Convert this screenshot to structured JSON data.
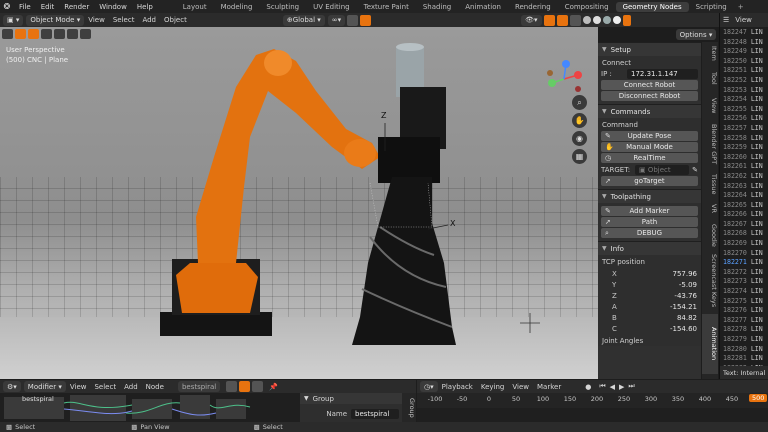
{
  "topbar": {
    "menus": [
      "File",
      "Edit",
      "Render",
      "Window",
      "Help"
    ],
    "workspaces": [
      "Layout",
      "Modeling",
      "Sculpting",
      "UV Editing",
      "Texture Paint",
      "Shading",
      "Animation",
      "Rendering",
      "Compositing",
      "Geometry Nodes",
      "Scripting"
    ],
    "active_workspace": "Geometry Nodes"
  },
  "viewport_header": {
    "mode": "Object Mode",
    "menus": [
      "View",
      "Select",
      "Add",
      "Object"
    ],
    "transform": "Global",
    "options": "Options"
  },
  "viewport": {
    "perspective": "User Perspective",
    "collection": "(500) CNC | Plane",
    "axis_z": "Z",
    "axis_x": "X"
  },
  "npanel": {
    "setup": {
      "title": "Setup",
      "connect_label": "Connect",
      "ip_label": "IP :",
      "ip_value": "172.31.1.147",
      "connect_button": "Connect Robot",
      "disconnect_button": "Disconnect Robot"
    },
    "commands": {
      "title": "Commands",
      "command_label": "Command",
      "update_pose": "Update Pose",
      "manual_mode": "Manual Mode",
      "realtime": "RealTime",
      "target_label": "TARGET:",
      "target_placeholder": "Object",
      "go_target": "goTarget"
    },
    "toolpathing": {
      "title": "Toolpathing",
      "add_marker": "Add Marker",
      "path": "Path",
      "debug": "DEBUG"
    },
    "info": {
      "title": "Info",
      "tcp_label": "TCP position",
      "rows": [
        {
          "k": "X",
          "v": "757.96"
        },
        {
          "k": "Y",
          "v": "-5.09"
        },
        {
          "k": "Z",
          "v": "-43.76"
        },
        {
          "k": "A",
          "v": "-154.21"
        },
        {
          "k": "B",
          "v": "84.82"
        },
        {
          "k": "C",
          "v": "-154.60"
        }
      ],
      "joint_label": "Joint Angles"
    }
  },
  "vtabs": [
    "Item",
    "Tool",
    "View",
    "Blender GPT",
    "Tissue",
    "VR",
    "Goodie",
    "Screencast Keys",
    "Animation"
  ],
  "text_editor": {
    "view": "View",
    "lines": [
      {
        "n": "182247",
        "t": "LIN"
      },
      {
        "n": "182248",
        "t": "LIN"
      },
      {
        "n": "182249",
        "t": "LIN"
      },
      {
        "n": "182250",
        "t": "LIN"
      },
      {
        "n": "182251",
        "t": "LIN"
      },
      {
        "n": "182252",
        "t": "LIN"
      },
      {
        "n": "182253",
        "t": "LIN"
      },
      {
        "n": "182254",
        "t": "LIN"
      },
      {
        "n": "182255",
        "t": "LIN"
      },
      {
        "n": "182256",
        "t": "LIN"
      },
      {
        "n": "182257",
        "t": "LIN"
      },
      {
        "n": "182258",
        "t": "LIN"
      },
      {
        "n": "182259",
        "t": "LIN"
      },
      {
        "n": "182260",
        "t": "LIN"
      },
      {
        "n": "182261",
        "t": "LIN"
      },
      {
        "n": "182262",
        "t": "LIN"
      },
      {
        "n": "182263",
        "t": "LIN"
      },
      {
        "n": "182264",
        "t": "LIN"
      },
      {
        "n": "182265",
        "t": "LIN"
      },
      {
        "n": "182266",
        "t": "LIN"
      },
      {
        "n": "182267",
        "t": "LIN"
      },
      {
        "n": "182268",
        "t": "LIN"
      },
      {
        "n": "182269",
        "t": "LIN"
      },
      {
        "n": "182270",
        "t": "LIN"
      },
      {
        "n": "182271",
        "t": "LIN"
      },
      {
        "n": "182272",
        "t": "LIN"
      },
      {
        "n": "182273",
        "t": "LIN"
      },
      {
        "n": "182274",
        "t": "LIN"
      },
      {
        "n": "182275",
        "t": "LIN"
      },
      {
        "n": "182276",
        "t": "LIN"
      },
      {
        "n": "182277",
        "t": "LIN"
      },
      {
        "n": "182278",
        "t": "LIN"
      },
      {
        "n": "182279",
        "t": "LIN"
      },
      {
        "n": "182280",
        "t": "LIN"
      },
      {
        "n": "182281",
        "t": "LIN"
      },
      {
        "n": "182282",
        "t": "LIN"
      },
      {
        "n": "182283",
        "t": "LIN"
      }
    ],
    "footer": "Text: Internal"
  },
  "node_editor": {
    "mode": "Modifier",
    "menus": [
      "View",
      "Select",
      "Add",
      "Node"
    ],
    "tree": "bestspiral",
    "node_label": "bestspiral",
    "group_title": "Group",
    "name_label": "Name",
    "name_value": "bestspiral",
    "side_tab": "Group"
  },
  "timeline": {
    "menus": [
      "Playback",
      "Keying",
      "View",
      "Marker"
    ],
    "ticks": [
      "-100",
      "-50",
      "0",
      "50",
      "100",
      "150",
      "200",
      "250",
      "300",
      "350",
      "400",
      "450"
    ],
    "current_frame": "500"
  },
  "status": {
    "items": [
      "Select",
      "Pan View",
      "Select"
    ]
  }
}
